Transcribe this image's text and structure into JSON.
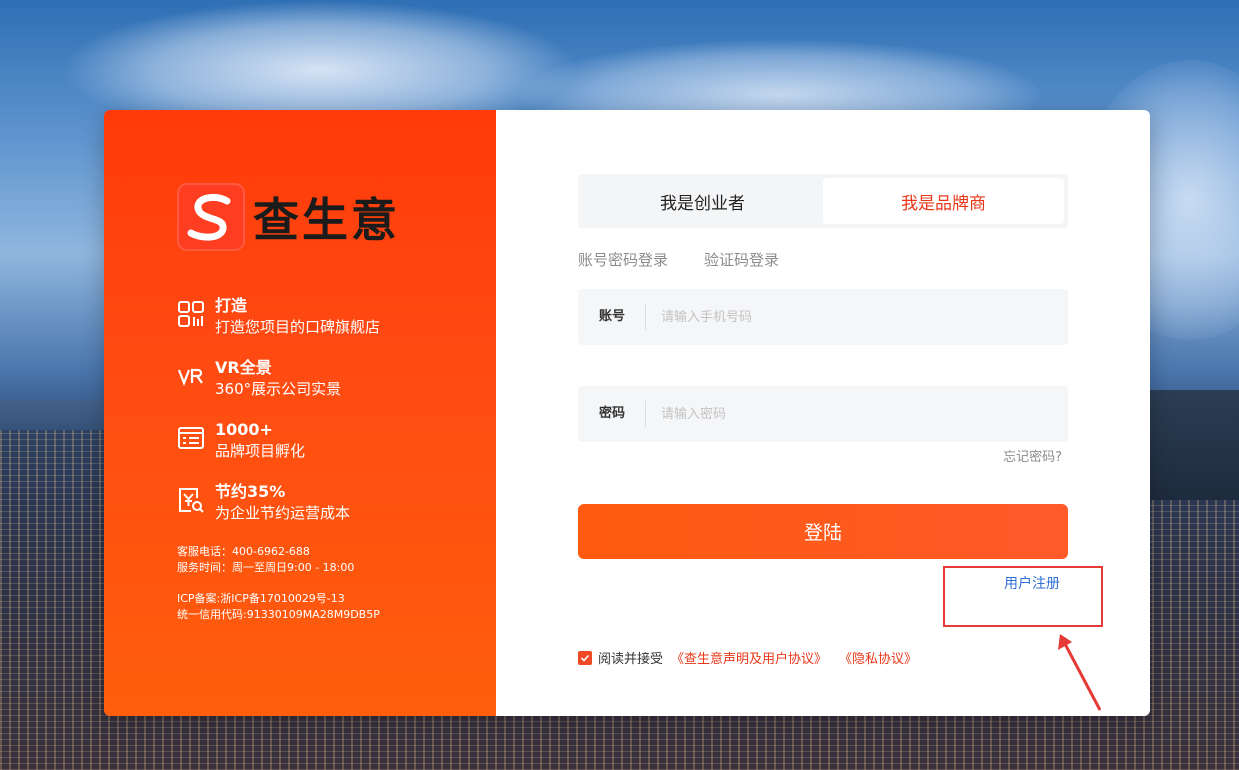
{
  "brand": {
    "name": "查生意"
  },
  "features": [
    {
      "icon": "qr-code-icon",
      "title": "打造",
      "desc": "打造您项目的口碑旗舰店"
    },
    {
      "icon": "vr-icon",
      "title": "VR全景",
      "desc": "360°展示公司实景"
    },
    {
      "icon": "list-doc-icon",
      "title": "1000+",
      "desc": "品牌项目孵化"
    },
    {
      "icon": "yen-search-icon",
      "title": "节约35%",
      "desc": "为企业节约运营成本"
    }
  ],
  "service": {
    "phone": "客服电话：400-6962-688",
    "hours": "服务时间：周一至周日9:00 - 18:00"
  },
  "icp": {
    "record": "ICP备案:浙ICP备17010029号-13",
    "credit": "统一信用代码:91330109MA28M9DB5P"
  },
  "role_tabs": [
    {
      "label": "我是创业者",
      "active": false
    },
    {
      "label": "我是品牌商",
      "active": true
    }
  ],
  "login_tabs": [
    {
      "label": "账号密码登录"
    },
    {
      "label": "验证码登录"
    }
  ],
  "account": {
    "label": "账号",
    "placeholder": "请输入手机号码",
    "value": ""
  },
  "password": {
    "label": "密码",
    "placeholder": "请输入密码",
    "value": ""
  },
  "forgot_label": "忘记密码?",
  "login_label": "登陆",
  "register_label": "用户注册",
  "agreement": {
    "checked": true,
    "text": "阅读并接受",
    "link1": "《查生意声明及用户协议》",
    "link2": "《隐私协议》"
  },
  "colors": {
    "brand_orange": "#ff4a12",
    "accent_red": "#e8381a",
    "link_blue": "#2f6fd6",
    "annotation_red": "#e53a36"
  }
}
